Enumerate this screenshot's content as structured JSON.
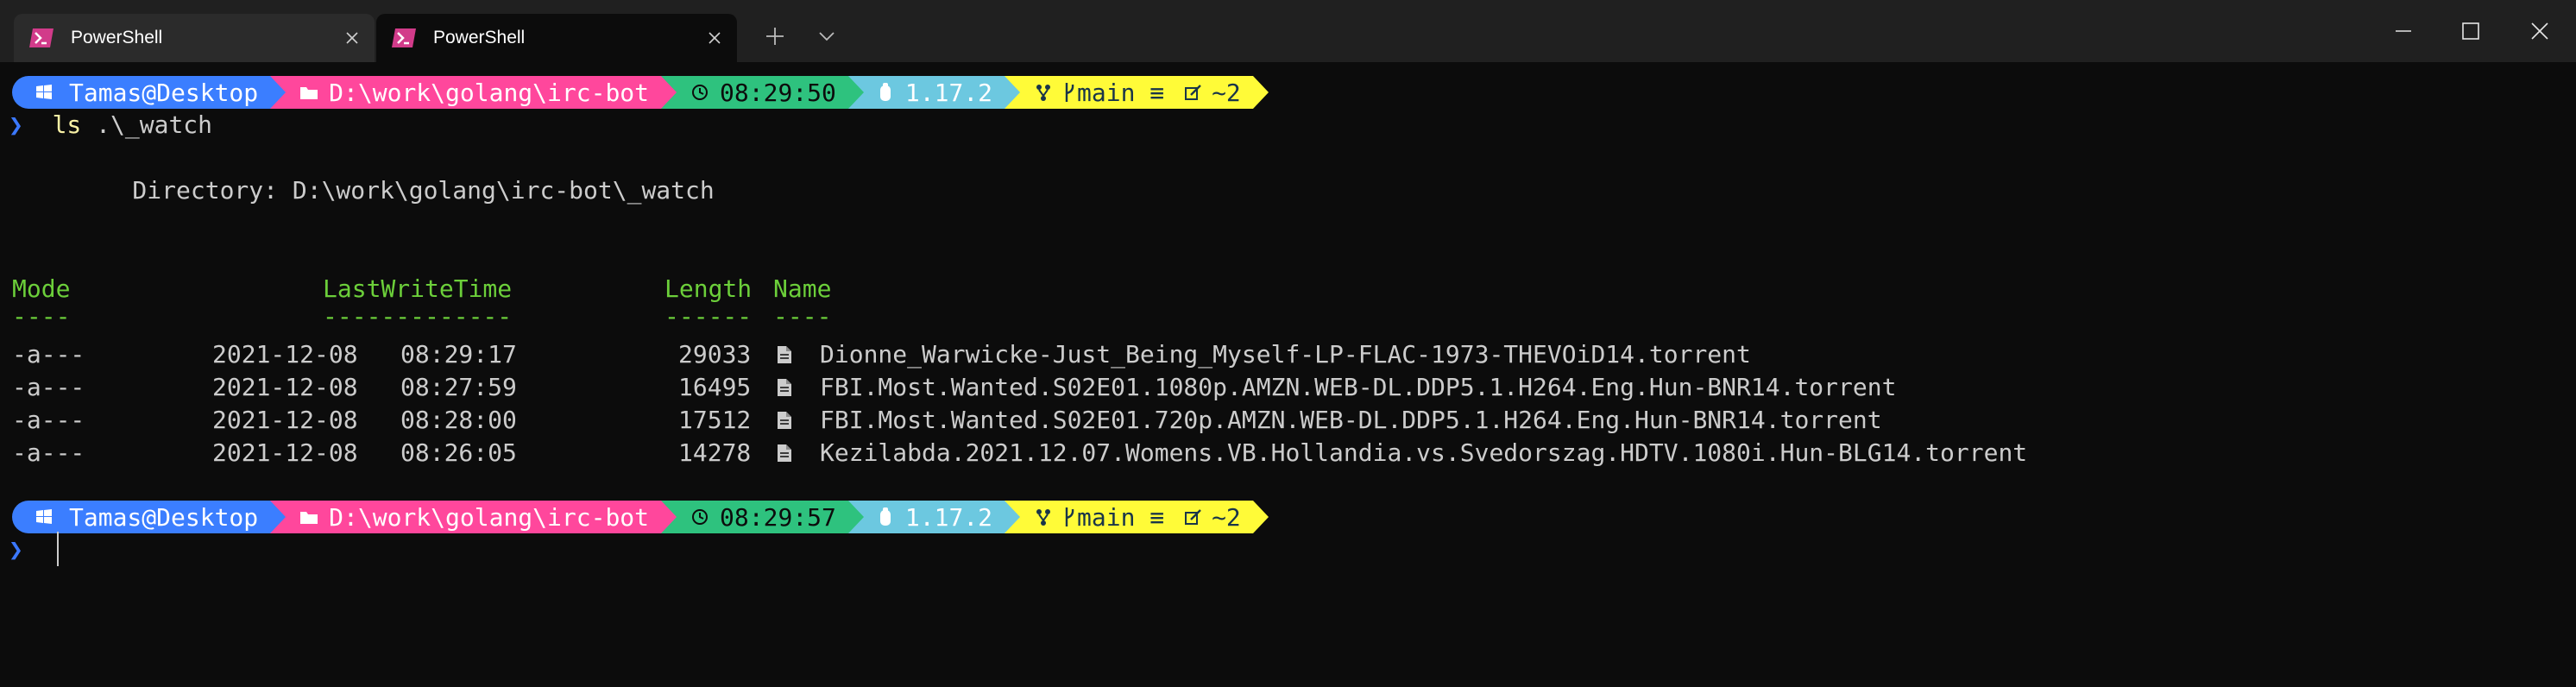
{
  "tabs": [
    {
      "label": "PowerShell",
      "active": false
    },
    {
      "label": "PowerShell",
      "active": true
    }
  ],
  "icons": {
    "new_tab": "plus-icon",
    "dropdown": "chevron-down-icon",
    "minimize": "minimize-icon",
    "maximize": "maximize-icon",
    "close": "close-icon"
  },
  "prompt1": {
    "user": "Tamas@Desktop",
    "path": "D:\\work\\golang\\irc-bot",
    "time": "08:29:50",
    "node": "1.17.2",
    "git": "main ≡ ",
    "git_changes": "~2"
  },
  "command": {
    "chevron": "❯",
    "name": "ls",
    "args": " .\\_watch"
  },
  "directory_line": "    Directory: D:\\work\\golang\\irc-bot\\_watch",
  "table": {
    "headers": {
      "mode": "Mode",
      "lastwrite": "LastWriteTime",
      "length": "Length",
      "name": "Name"
    },
    "underlines": {
      "mode": "----",
      "lastwrite": "-------------",
      "length": "------",
      "name": "----"
    },
    "rows": [
      {
        "mode": "-a---",
        "date": "2021-12-08",
        "time": "08:29:17",
        "length": "29033",
        "name": "Dionne_Warwicke-Just_Being_Myself-LP-FLAC-1973-THEVOiD14.torrent"
      },
      {
        "mode": "-a---",
        "date": "2021-12-08",
        "time": "08:27:59",
        "length": "16495",
        "name": "FBI.Most.Wanted.S02E01.1080p.AMZN.WEB-DL.DDP5.1.H264.Eng.Hun-BNR14.torrent"
      },
      {
        "mode": "-a---",
        "date": "2021-12-08",
        "time": "08:28:00",
        "length": "17512",
        "name": "FBI.Most.Wanted.S02E01.720p.AMZN.WEB-DL.DDP5.1.H264.Eng.Hun-BNR14.torrent"
      },
      {
        "mode": "-a---",
        "date": "2021-12-08",
        "time": "08:26:05",
        "length": "14278",
        "name": "Kezilabda.2021.12.07.Womens.VB.Hollandia.vs.Svedorszag.HDTV.1080i.Hun-BLG14.torrent"
      }
    ]
  },
  "prompt2": {
    "user": "Tamas@Desktop",
    "path": "D:\\work\\golang\\irc-bot",
    "time": "08:29:57",
    "node": "1.17.2",
    "git": "main ≡ ",
    "git_changes": "~2"
  },
  "colors": {
    "user": "#3b7eff",
    "path": "#ff479c",
    "time": "#2ec27e",
    "node": "#6cc8e0",
    "git": "#fffb38",
    "header": "#6ccf3a",
    "background": "#0c0c0c"
  }
}
